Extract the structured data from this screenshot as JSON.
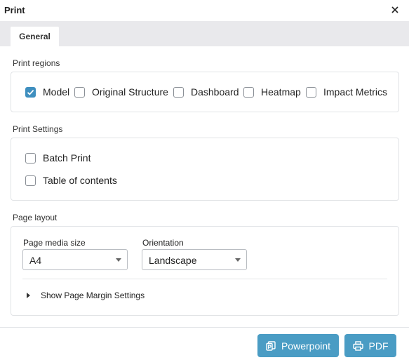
{
  "dialog": {
    "title": "Print"
  },
  "tabs": [
    {
      "label": "General"
    }
  ],
  "print_regions": {
    "label": "Print regions",
    "options": [
      {
        "label": "Model",
        "checked": true
      },
      {
        "label": "Original Structure",
        "checked": false
      },
      {
        "label": "Dashboard",
        "checked": false
      },
      {
        "label": "Heatmap",
        "checked": false
      },
      {
        "label": "Impact Metrics",
        "checked": false
      }
    ]
  },
  "print_settings": {
    "label": "Print Settings",
    "options": [
      {
        "label": "Batch Print",
        "checked": false
      },
      {
        "label": "Table of contents",
        "checked": false
      }
    ]
  },
  "page_layout": {
    "label": "Page layout",
    "media_size": {
      "label": "Page media size",
      "value": "A4"
    },
    "orientation": {
      "label": "Orientation",
      "value": "Landscape"
    },
    "margin_toggle": "Show Page Margin Settings"
  },
  "footer": {
    "powerpoint_label": "Powerpoint",
    "pdf_label": "PDF"
  },
  "colors": {
    "accent": "#4a9cc4",
    "checkbox_checked": "#3f8fbf"
  }
}
